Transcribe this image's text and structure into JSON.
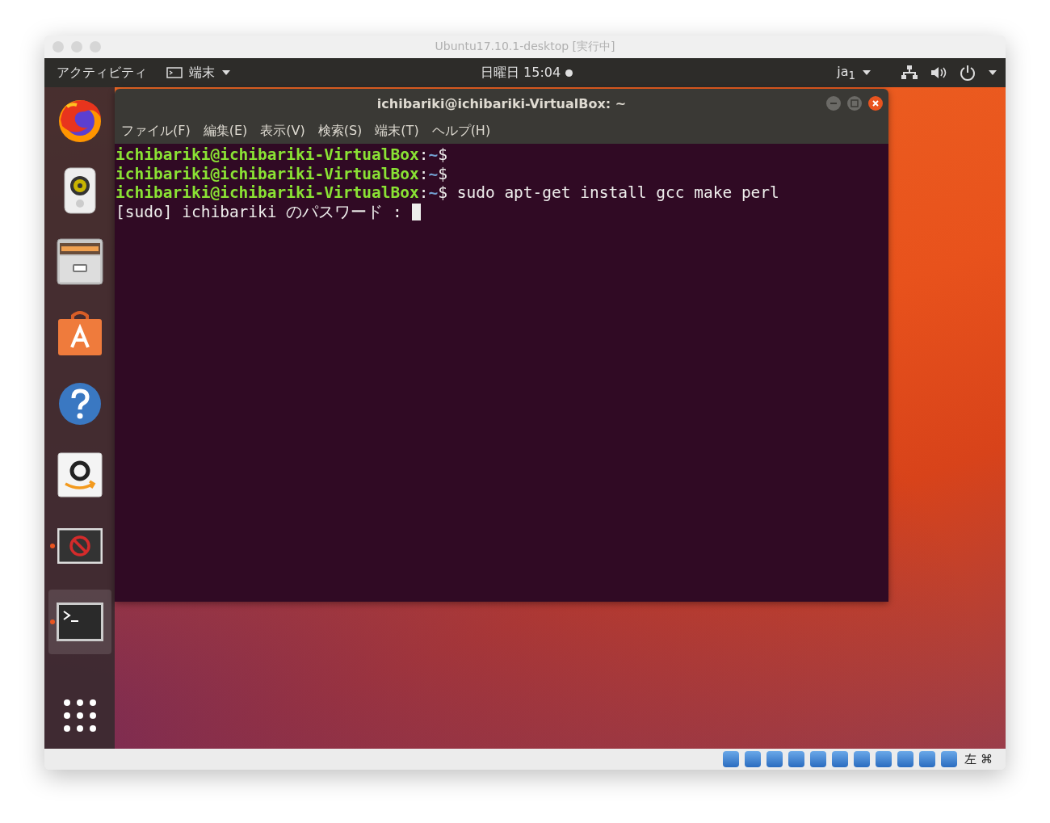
{
  "window": {
    "title": "Ubuntu17.10.1-desktop [実行中]"
  },
  "top_bar": {
    "activities": "アクティビティ",
    "app_menu": "端末",
    "clock": "日曜日 15:04",
    "input_method": "ja$_{1}$"
  },
  "dock": {
    "items": [
      {
        "kind": "firefox",
        "running": false,
        "selected": false
      },
      {
        "kind": "speaker",
        "running": false,
        "selected": false
      },
      {
        "kind": "files",
        "running": false,
        "selected": false
      },
      {
        "kind": "software",
        "running": false,
        "selected": false
      },
      {
        "kind": "help",
        "running": false,
        "selected": false
      },
      {
        "kind": "amazon",
        "running": false,
        "selected": false
      },
      {
        "kind": "blocked",
        "running": true,
        "selected": false
      },
      {
        "kind": "terminal",
        "running": true,
        "selected": true
      }
    ]
  },
  "terminal": {
    "title": "ichibariki@ichibariki-VirtualBox: ~",
    "menu": [
      "ファイル(F)",
      "編集(E)",
      "表示(V)",
      "検索(S)",
      "端末(T)",
      "ヘルプ(H)"
    ],
    "lines": [
      {
        "kind": "prompt",
        "user": "ichibariki@ichibariki-VirtualBox",
        "colon": ":",
        "path": "~",
        "sign": "$"
      },
      {
        "kind": "prompt",
        "user": "ichibariki@ichibariki-VirtualBox",
        "colon": ":",
        "path": "~",
        "sign": "$"
      },
      {
        "kind": "prompt",
        "user": "ichibariki@ichibariki-VirtualBox",
        "colon": ":",
        "path": "~",
        "sign": "$",
        "command": " sudo apt-get install gcc make perl"
      },
      {
        "kind": "output",
        "text": "[sudo] ichibariki のパスワード : ",
        "cursor": true
      }
    ]
  },
  "status_bar": {
    "host_key": "左 ⌘"
  }
}
